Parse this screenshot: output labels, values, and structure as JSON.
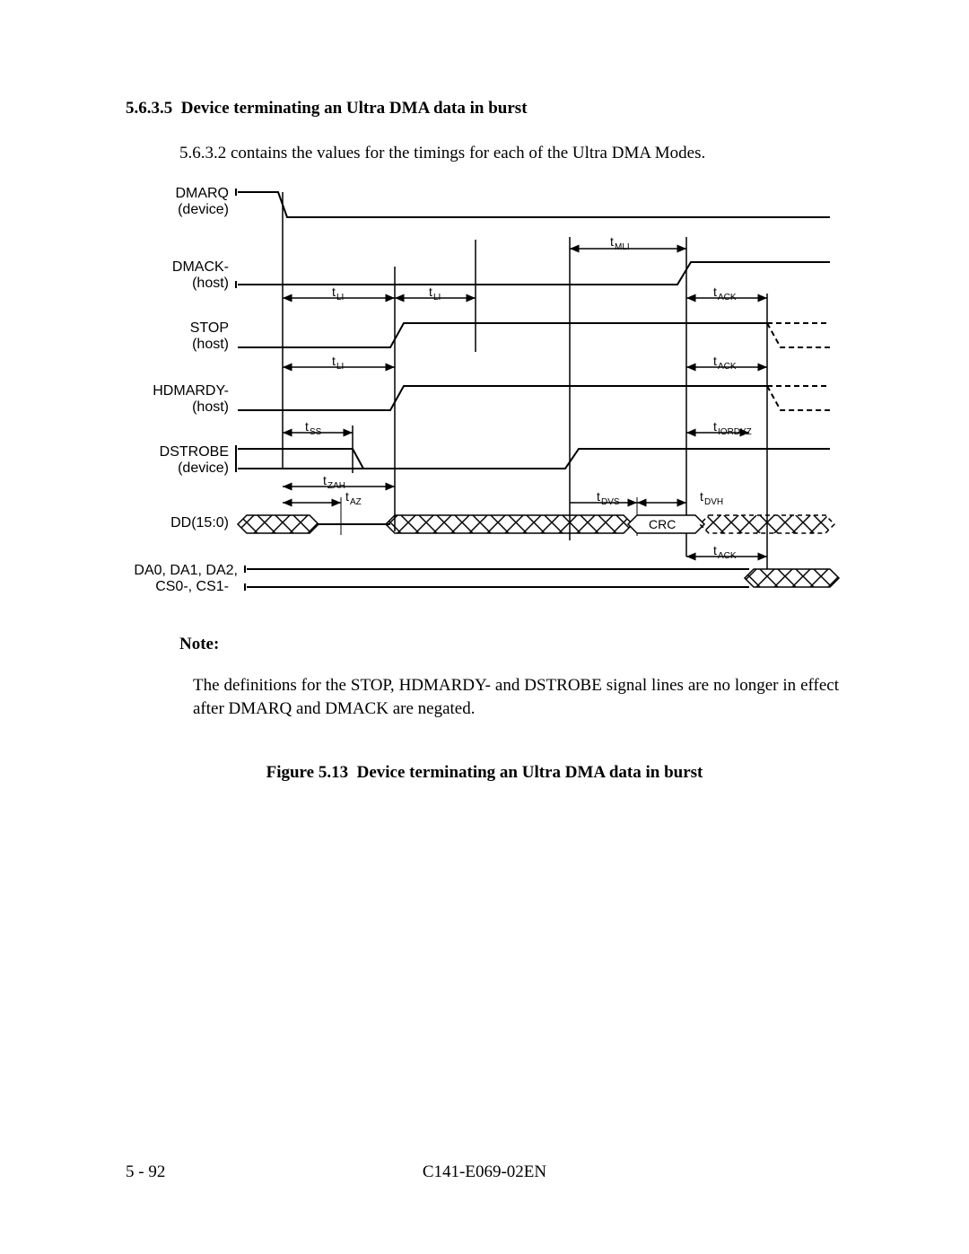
{
  "section": {
    "number": "5.6.3.5",
    "title": "Device terminating an Ultra DMA data in burst"
  },
  "intro": "5.6.3.2 contains the values for the timings for each of the Ultra DMA Modes.",
  "note_label": "Note:",
  "note_body": "The definitions for the STOP, HDMARDY- and DSTROBE signal lines are no longer in effect after DMARQ and DMACK are negated.",
  "figure": {
    "number": "Figure 5.13",
    "title": "Device terminating an Ultra DMA data in burst"
  },
  "footer": {
    "page": "5 - 92",
    "docid": "C141-E069-02EN"
  },
  "diagram": {
    "signals": [
      {
        "name": "DMARQ",
        "sub": "(device)"
      },
      {
        "name": "DMACK-",
        "sub": "(host)"
      },
      {
        "name": "STOP",
        "sub": "(host)"
      },
      {
        "name": "HDMARDY-",
        "sub": "(host)"
      },
      {
        "name": "DSTROBE",
        "sub": "(device)"
      },
      {
        "name": "DD(15:0)",
        "sub": ""
      },
      {
        "name": "DA0, DA1, DA2,",
        "sub": "CS0-, CS1-"
      }
    ],
    "timings": {
      "tMLI": "MLI",
      "tLI": "LI",
      "tACK": "ACK",
      "tSS": "SS",
      "tIORDYZ": "IORDYZ",
      "tZAH": "ZAH",
      "tAZ": "AZ",
      "tDVS": "DVS",
      "tDVH": "DVH"
    },
    "crc_label": "CRC"
  }
}
